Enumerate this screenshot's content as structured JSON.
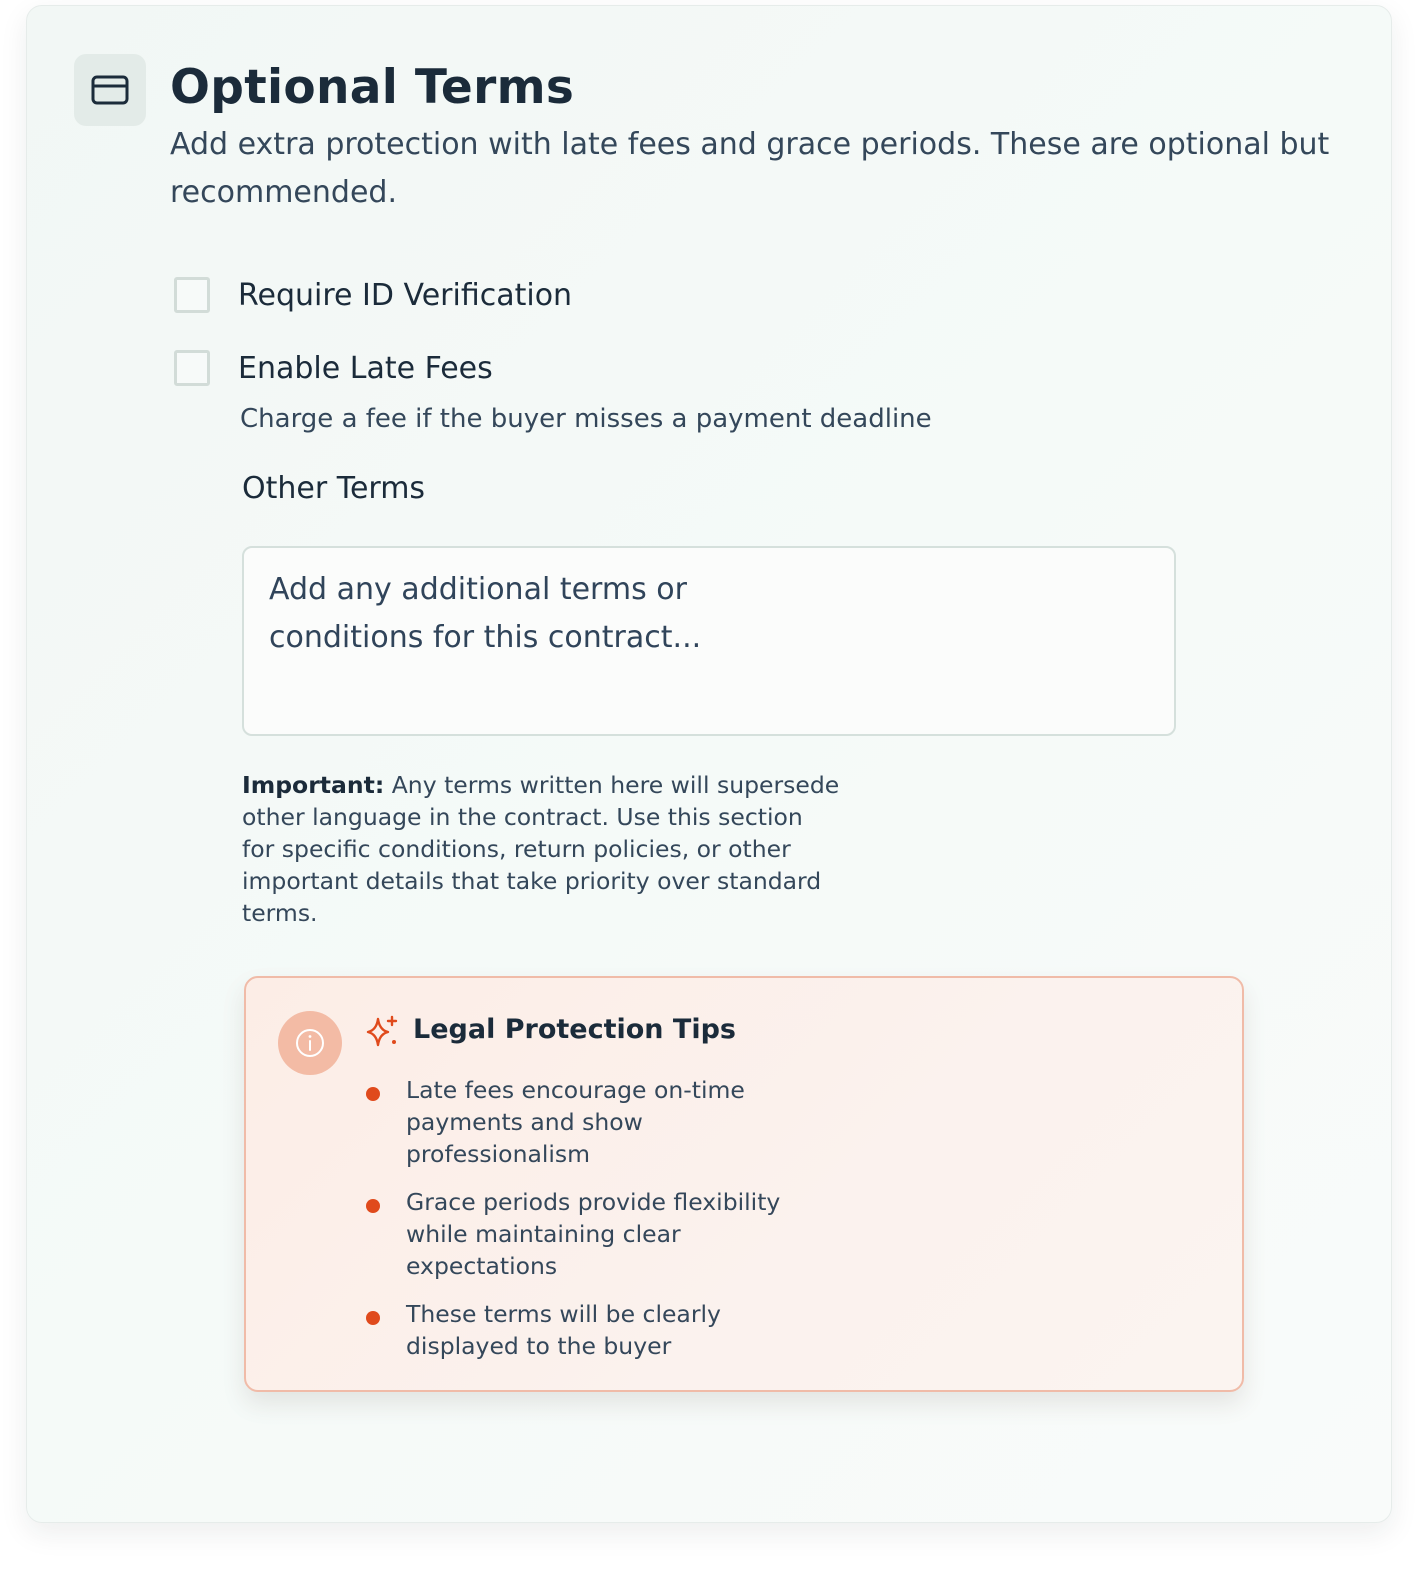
{
  "header": {
    "icon": "credit-card-icon",
    "title": "Optional Terms",
    "subtitle": "Add extra protection with late fees and grace periods. These are optional but recommended."
  },
  "options": {
    "id_verification": {
      "label": "Require ID Verification",
      "checked": false
    },
    "late_fees": {
      "label": "Enable Late Fees",
      "checked": false,
      "help": "Charge a fee if the buyer misses a payment deadline"
    }
  },
  "other_terms": {
    "label": "Other Terms",
    "placeholder": "Add any additional terms or conditions for this contract...",
    "value": "",
    "note_strong": "Important:",
    "note_text": " Any terms written here will supersede other language in the contract. Use this section for specific conditions, return policies, or other important details that take priority over standard terms."
  },
  "tips": {
    "icon": "info-icon",
    "title_icon": "sparkle-icon",
    "title": "Legal Protection Tips",
    "items": [
      "Late fees encourage on-time payments and show professionalism",
      "Grace periods provide flexibility while maintaining clear expectations",
      "These terms will be clearly displayed to the buyer"
    ]
  },
  "colors": {
    "accent": "#e04a1c",
    "tips_border": "#f0bba8",
    "text_dark": "#1b2b3a"
  }
}
